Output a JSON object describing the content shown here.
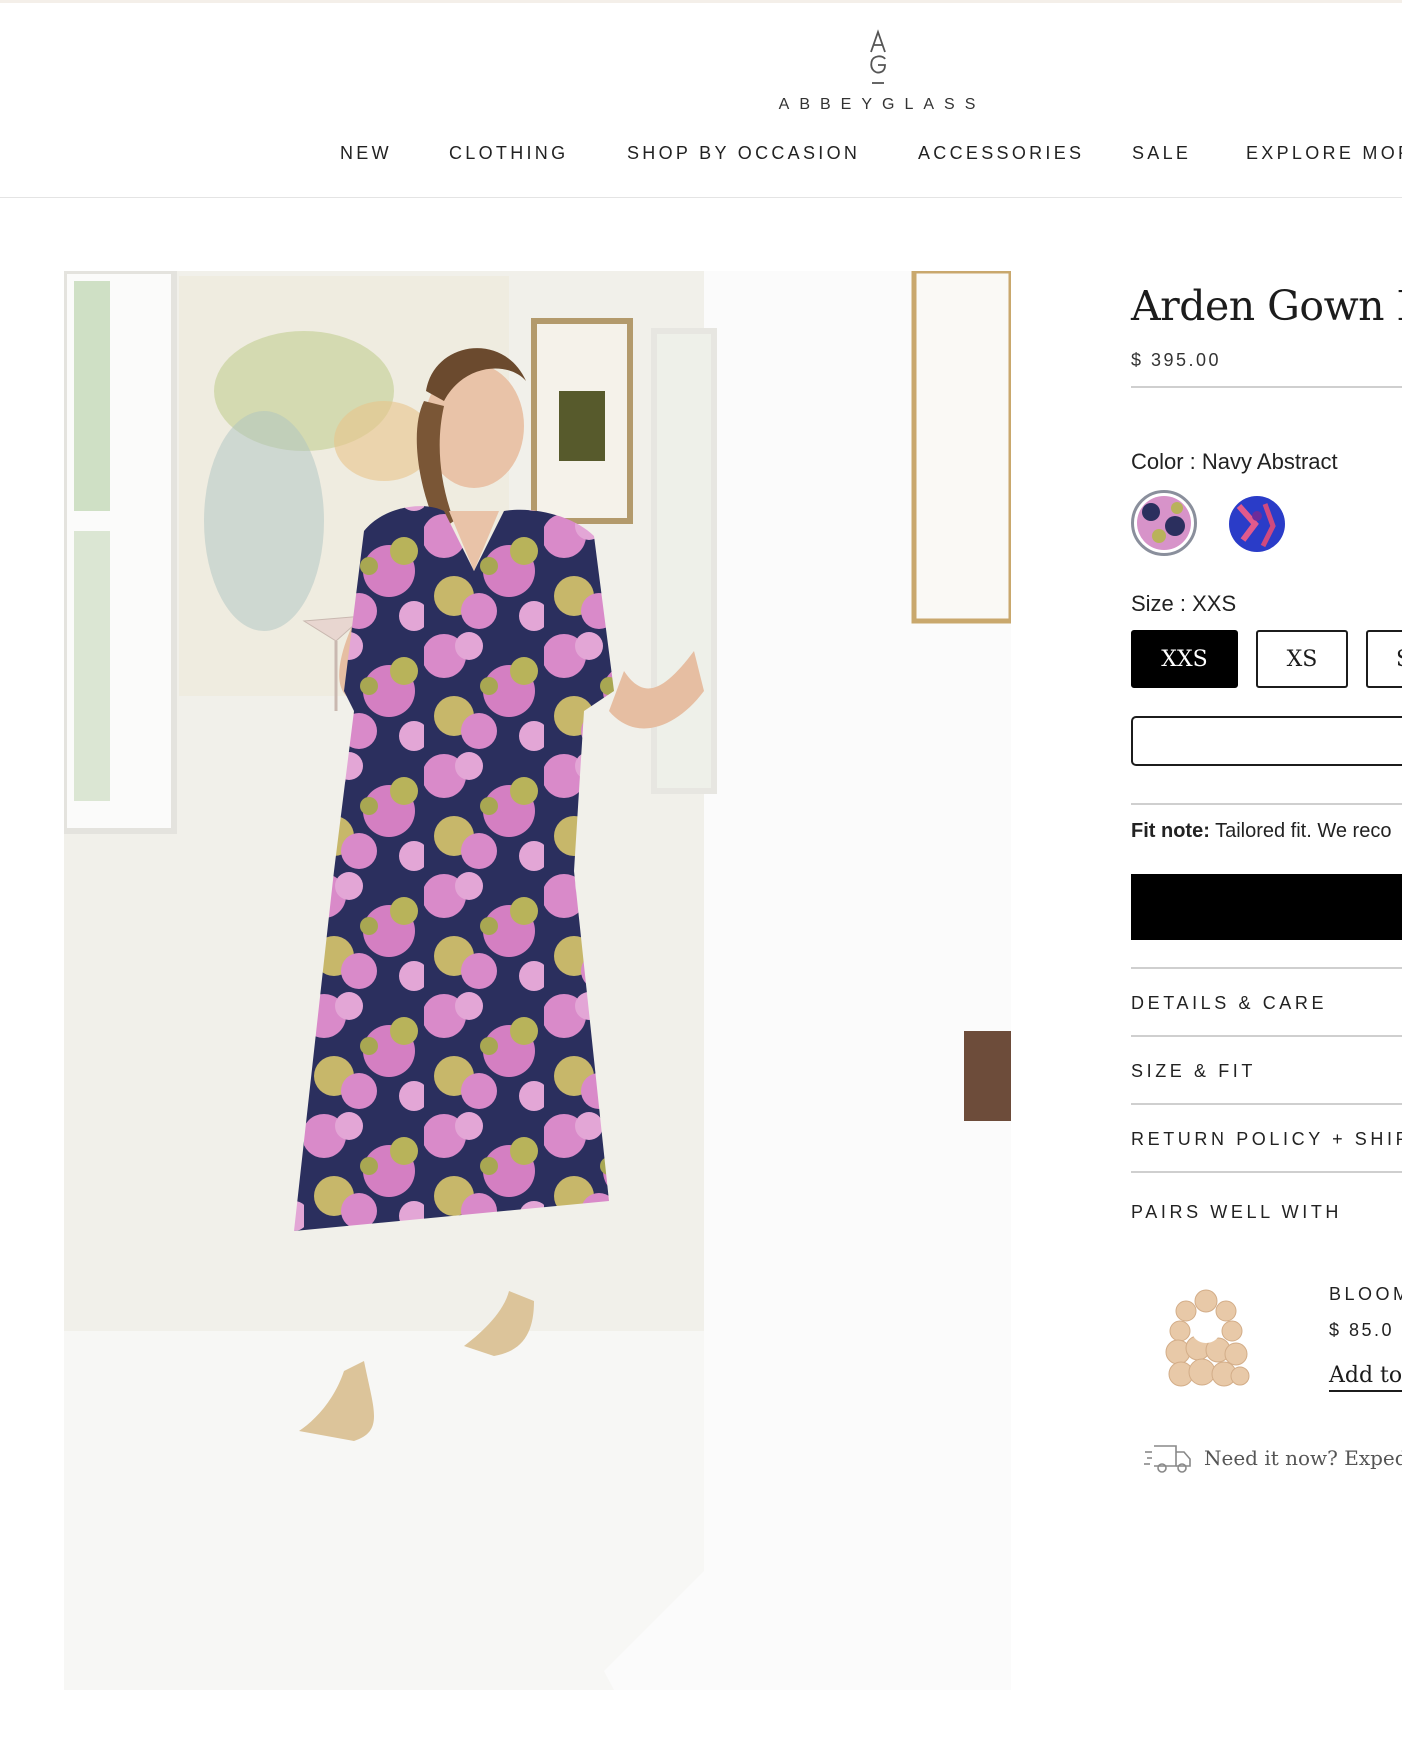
{
  "brand": {
    "mark": "AG",
    "wordmark": "ABBEYGLASS"
  },
  "nav": {
    "items": [
      "NEW",
      "CLOTHING",
      "SHOP BY OCCASION",
      "ACCESSORIES",
      "SALE",
      "EXPLORE MOR"
    ]
  },
  "product": {
    "title": "Arden Gown Na",
    "price": "$ 395.00",
    "color_label": "Color : Navy Abstract",
    "size_label": "Size : XXS",
    "sizes": [
      "XXS",
      "XS",
      "S"
    ],
    "selected_size": "XXS",
    "fit_note_label": "Fit note:",
    "fit_note_text": " Tailored fit. We reco",
    "colors": {
      "selected_swatch": "#d793c9",
      "alt_swatch": "#2a3cc8",
      "accent": "#000000"
    }
  },
  "accordions": [
    "DETAILS & CARE",
    "SIZE & FIT",
    "RETURN POLICY + SHIPPI"
  ],
  "pairs": {
    "heading": "PAIRS WELL WITH",
    "item_name": "BLOOM",
    "item_price": "$ 85.0",
    "add_label": "Add to"
  },
  "expedite": {
    "text": "Need it now? Expedite",
    "icon": "delivery-truck-icon"
  }
}
